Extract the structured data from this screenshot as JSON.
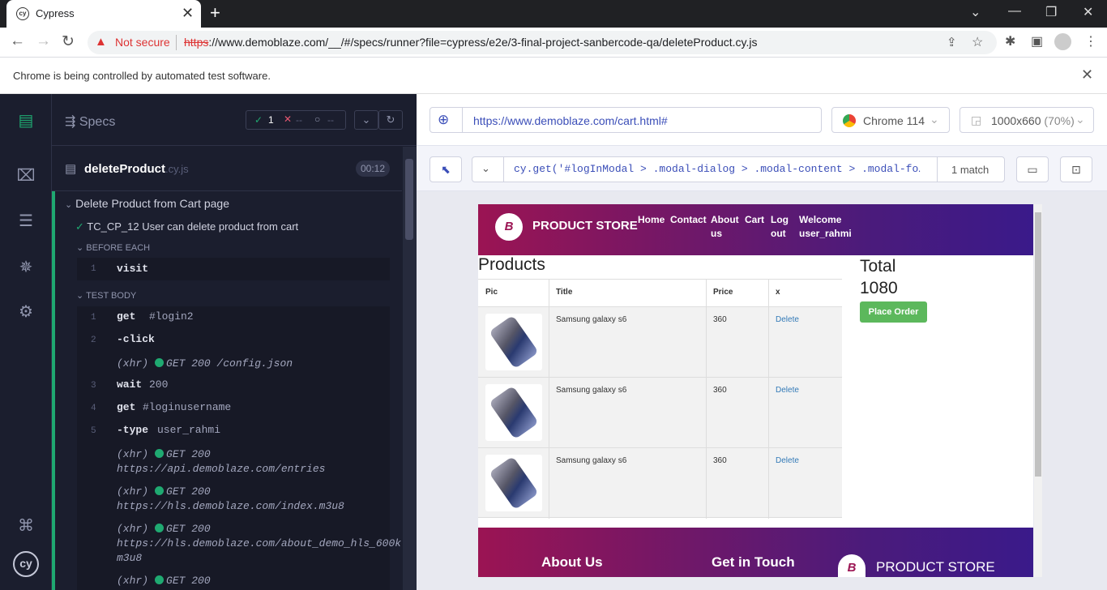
{
  "browser": {
    "tab_title": "Cypress",
    "not_secure": "Not secure",
    "url_scheme": "https",
    "url_rest": "://www.demoblaze.com/__/#/specs/runner?file=cypress/e2e/3-final-project-sanbercode-qa/deleteProduct.cy.js",
    "automation_message": "Chrome is being controlled by automated test software."
  },
  "reporter": {
    "specs_label": "Specs",
    "passed": "1",
    "failed": "--",
    "pending": "--",
    "file_name": "deleteProduct",
    "file_ext": ".cy.js",
    "duration": "00:12",
    "suite": "Delete Product from Cart page",
    "test": "TC_CP_12 User can delete product from cart",
    "before_each": "BEFORE EACH",
    "test_body": "TEST BODY",
    "before_cmds": [
      {
        "n": "1",
        "cmd": "visit",
        "arg": ""
      }
    ],
    "body_cmds": [
      {
        "n": "1",
        "cmd": "get",
        "arg": "#login2"
      },
      {
        "n": "2",
        "cmd": "-click",
        "arg": ""
      },
      {
        "xhr": "(xhr)",
        "req": "GET 200 /config.json"
      },
      {
        "n": "3",
        "cmd": "wait",
        "arg": "200"
      },
      {
        "n": "4",
        "cmd": "get",
        "arg": "#loginusername"
      },
      {
        "n": "5",
        "cmd": "-type",
        "arg": "user_rahmi"
      },
      {
        "xhr": "(xhr)",
        "req": "GET 200",
        "url": "https://api.demoblaze.com/entries"
      },
      {
        "xhr": "(xhr)",
        "req": "GET 200",
        "url": "https://hls.demoblaze.com/index.m3u8"
      },
      {
        "xhr": "(xhr)",
        "req": "GET 200",
        "url": "https://hls.demoblaze.com/about_demo_hls_600k.",
        "url2": "m3u8"
      },
      {
        "xhr": "(xhr)",
        "req": "GET 200"
      }
    ]
  },
  "aut": {
    "url": "https://www.demoblaze.com/cart.html#",
    "browser_name": "Chrome 114",
    "viewport": "1000x660",
    "scale": "(70%)",
    "selector_prefix": "cy.get(",
    "selector": "'#logInModal > .modal-dialog > .modal-content > .modal-fo…",
    "match_count": "1 match"
  },
  "site": {
    "brand": "PRODUCT STORE",
    "logo_letter": "B",
    "nav": [
      {
        "l1": "Home",
        "l2": ""
      },
      {
        "l1": "Contact",
        "l2": ""
      },
      {
        "l1": "About",
        "l2": "us"
      },
      {
        "l1": "Cart",
        "l2": ""
      },
      {
        "l1": "Log",
        "l2": "out"
      },
      {
        "l1": "Welcome",
        "l2": "user_rahmi"
      }
    ],
    "products_heading": "Products",
    "total_label": "Total",
    "total_value": "1080",
    "place_order": "Place Order",
    "columns": [
      "Pic",
      "Title",
      "Price",
      "x"
    ],
    "rows": [
      {
        "title": "Samsung galaxy s6",
        "price": "360",
        "action": "Delete"
      },
      {
        "title": "Samsung galaxy s6",
        "price": "360",
        "action": "Delete"
      },
      {
        "title": "Samsung galaxy s6",
        "price": "360",
        "action": "Delete"
      }
    ],
    "footer": {
      "about": "About Us",
      "contact": "Get in Touch",
      "brand": "PRODUCT STORE"
    }
  }
}
